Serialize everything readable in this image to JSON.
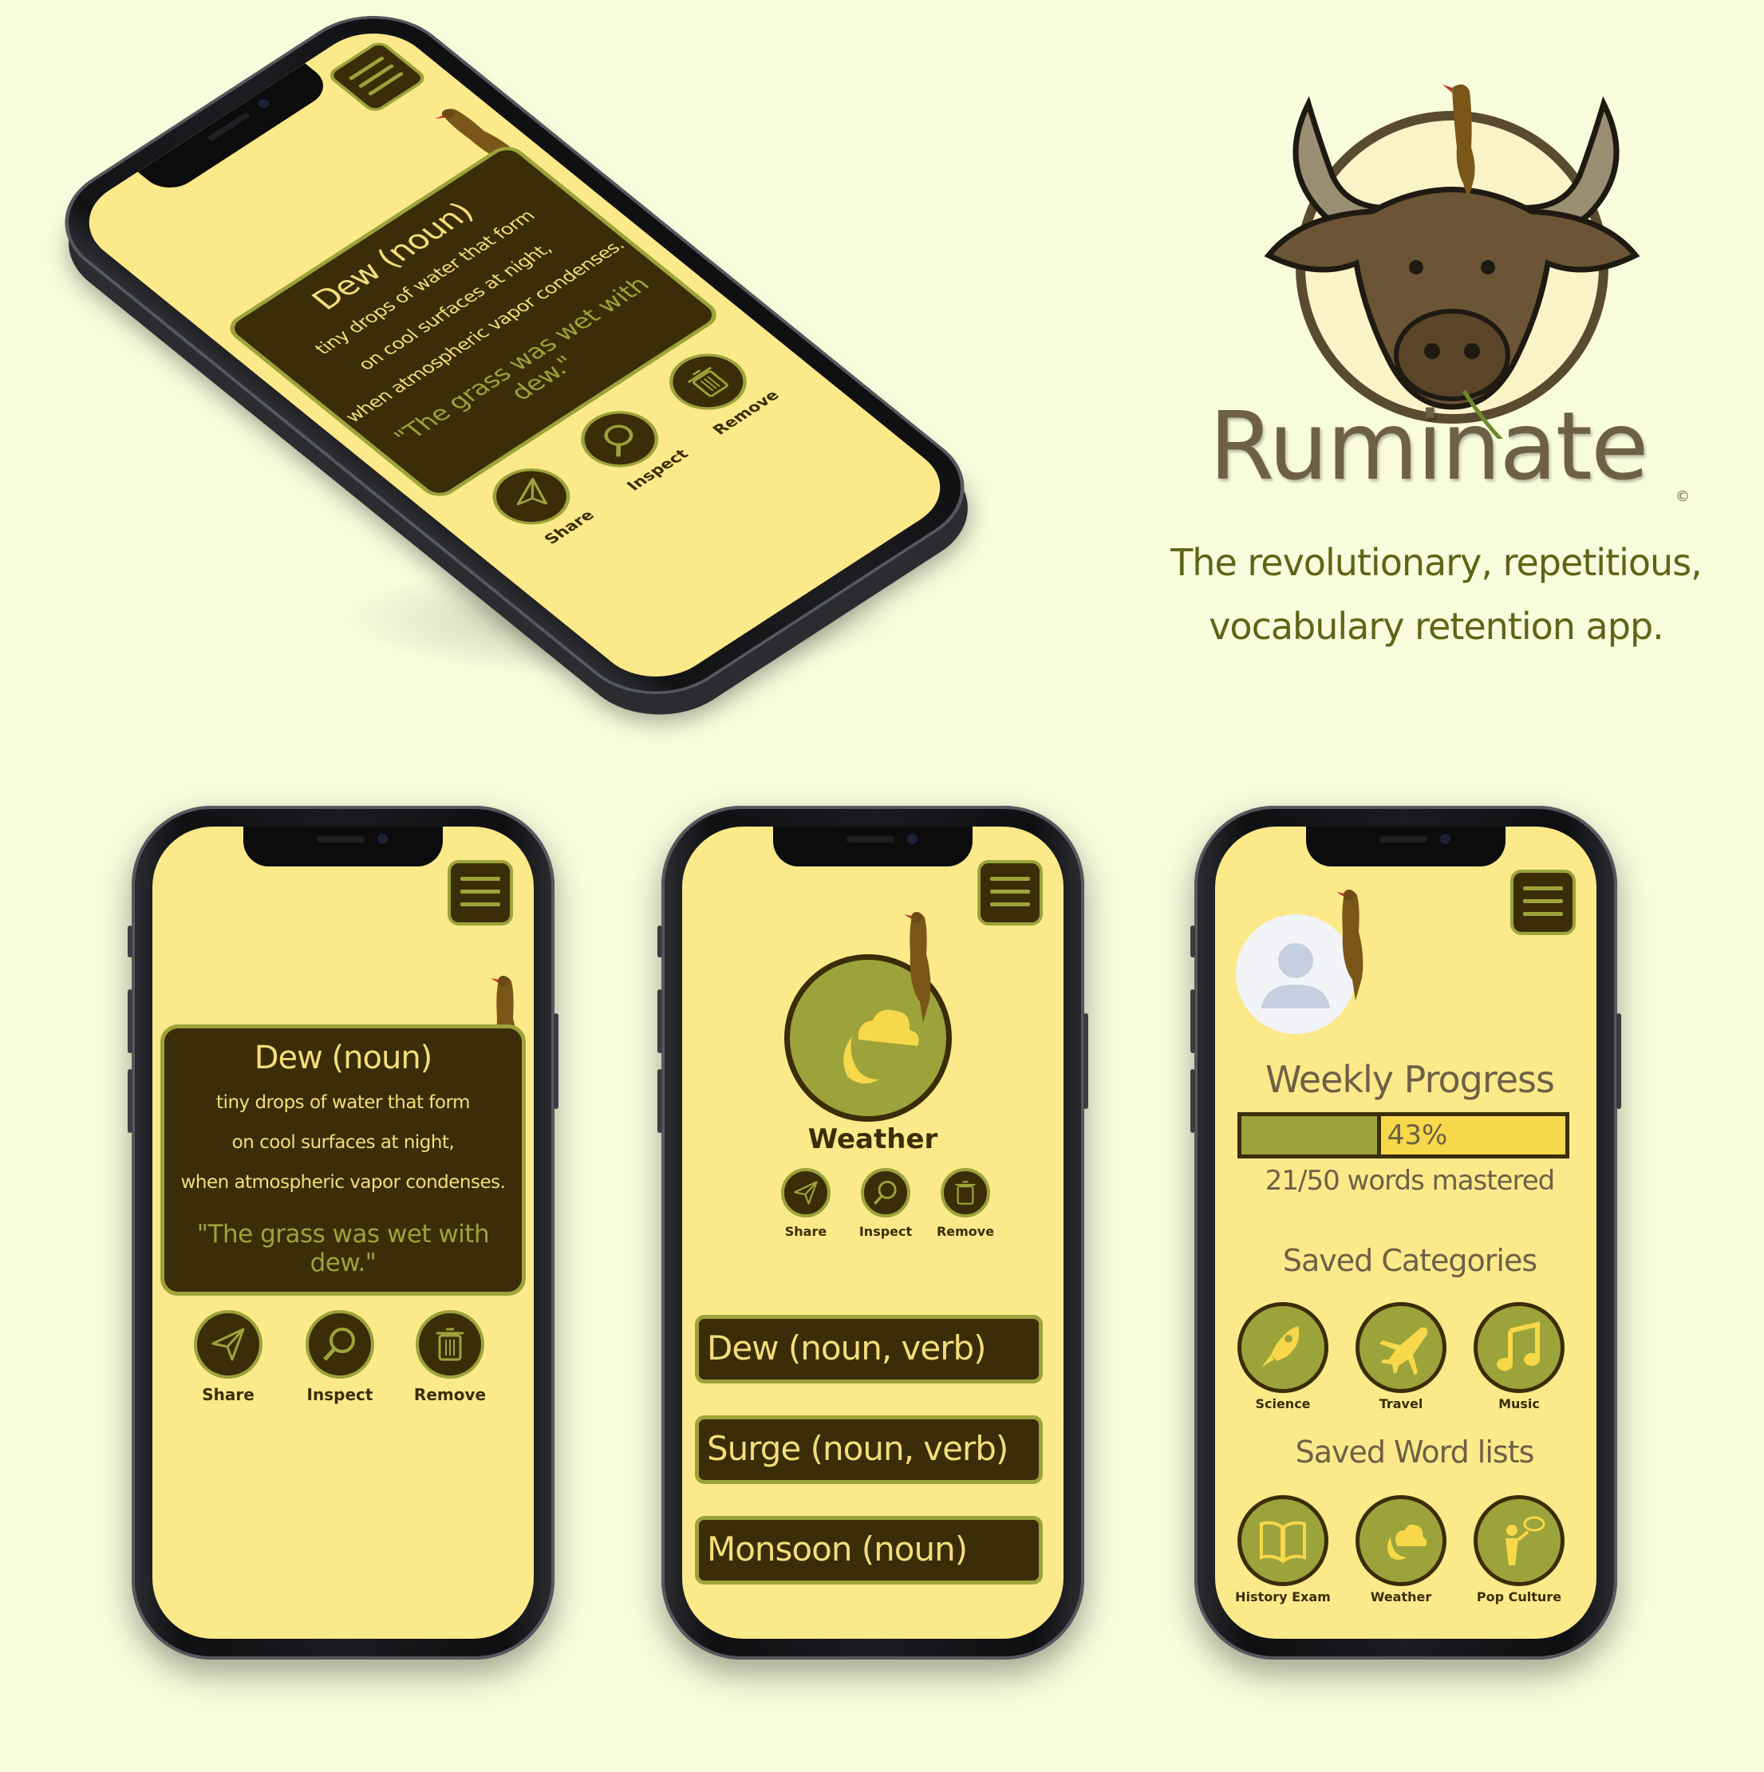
{
  "brand": {
    "name": "Ruminate",
    "copyright": "©",
    "tagline_line1": "The revolutionary, repetitious,",
    "tagline_line2": "vocabulary retention app.",
    "colors": {
      "background": "#f8fbdc",
      "screen": "#fbe98a",
      "dark": "#3b2d08",
      "accent": "#9ca33b",
      "text_light": "#f4dd7a"
    }
  },
  "definition_card": {
    "title": "Dew (noun)",
    "line1": "tiny drops of water that form",
    "line2": "on cool surfaces at night,",
    "line3": "when atmospheric vapor condenses.",
    "example": "\"The grass was wet with dew.\""
  },
  "actions": {
    "share": "Share",
    "inspect": "Inspect",
    "remove": "Remove",
    "icons": [
      "paper-plane-icon",
      "magnifier-icon",
      "trash-icon"
    ]
  },
  "category_screen": {
    "title": "Weather",
    "words": [
      "Dew (noun, verb)",
      "Surge (noun, verb)",
      "Monsoon (noun)"
    ]
  },
  "profile_screen": {
    "weekly_progress_title": "Weekly Progress",
    "progress_percent": 43,
    "progress_label": "43%",
    "mastered_text": "21/50 words mastered",
    "saved_categories_title": "Saved Categories",
    "saved_categories": [
      "Science",
      "Travel",
      "Music"
    ],
    "saved_lists_title": "Saved Word lists",
    "saved_lists": [
      "History Exam",
      "Weather",
      "Pop Culture"
    ]
  }
}
